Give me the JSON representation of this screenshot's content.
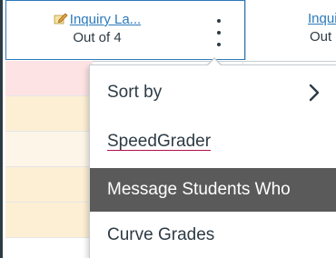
{
  "gradebook": {
    "active_column": {
      "title": "Inquiry La...",
      "subtitle": "Out of 4"
    },
    "next_column": {
      "title": "Inqui",
      "subtitle": "Out"
    },
    "cell_colors": [
      "#fde3e3",
      "#fdefd3",
      "#fdf5e8",
      "#fdefd3",
      "#fdefd3"
    ]
  },
  "column_menu": {
    "items": [
      {
        "label": "Sort by"
      },
      {
        "label": "SpeedGrader"
      },
      {
        "label": "Message Students Who"
      },
      {
        "label": "Curve Grades"
      }
    ]
  },
  "icons": {
    "column_icon": "pencil-note-icon",
    "options": "kebab-menu-icon",
    "submenu": "chevron-right-icon"
  }
}
